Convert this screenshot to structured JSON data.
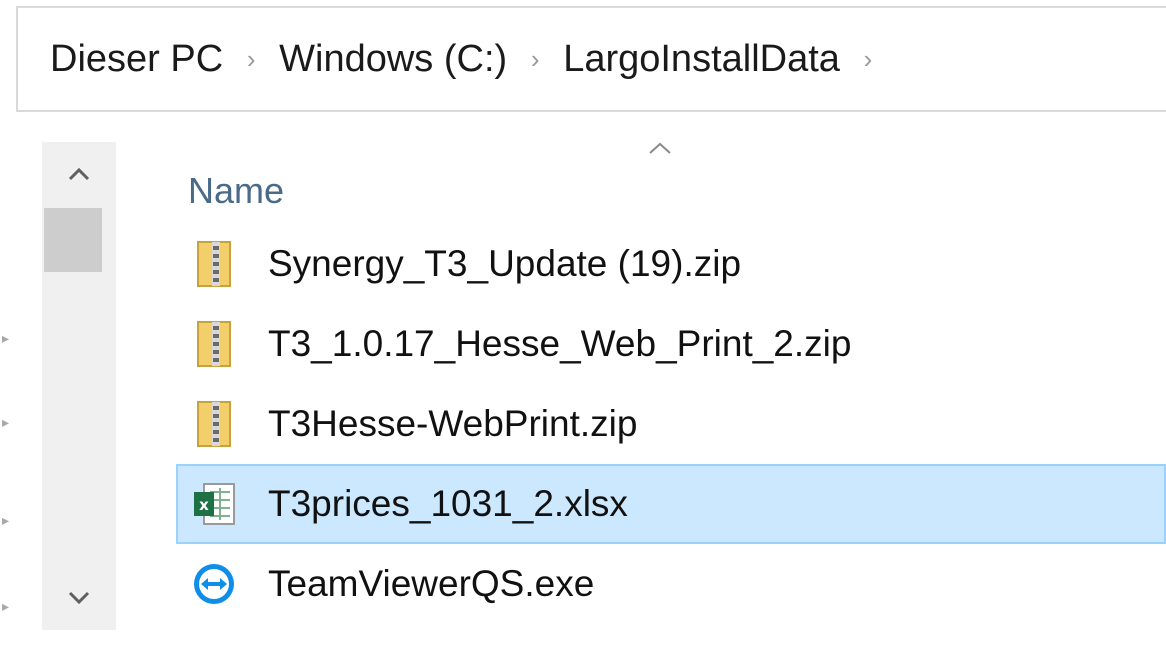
{
  "breadcrumb": {
    "items": [
      "Dieser PC",
      "Windows (C:)",
      "LargoInstallData"
    ],
    "separator": "›"
  },
  "column_header": {
    "name_label": "Name",
    "sort": "ascending"
  },
  "files": [
    {
      "name": "Synergy_T3_Update (19).zip",
      "icon": "zip-folder-icon",
      "selected": false
    },
    {
      "name": "T3_1.0.17_Hesse_Web_Print_2.zip",
      "icon": "zip-folder-icon",
      "selected": false
    },
    {
      "name": "T3Hesse-WebPrint.zip",
      "icon": "zip-folder-icon",
      "selected": false
    },
    {
      "name": "T3prices_1031_2.xlsx",
      "icon": "excel-icon",
      "selected": true
    },
    {
      "name": "TeamViewerQS.exe",
      "icon": "teamviewer-icon",
      "selected": false
    }
  ],
  "colors": {
    "selection_bg": "#cce8ff",
    "selection_border": "#99d1ff",
    "header_text": "#4a6a8a",
    "excel_green": "#1e7145",
    "teamviewer_blue": "#0e8ee9",
    "zip_yellow": "#f2cf6a"
  }
}
